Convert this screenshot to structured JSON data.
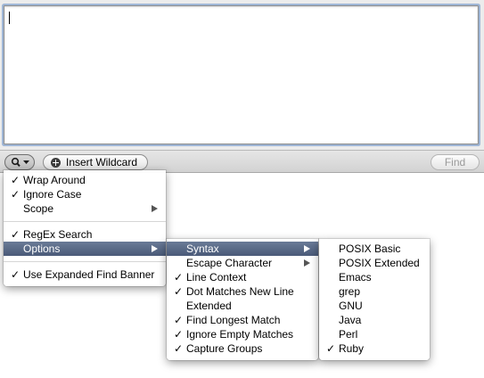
{
  "find_panel": {
    "find_button_label": "Find",
    "insert_wildcard_label": "Insert Wildcard",
    "search_options_icon": "magnifier-dropdown-icon"
  },
  "menu_main": {
    "items": [
      {
        "label": "Wrap Around",
        "checked": true
      },
      {
        "label": "Ignore Case",
        "checked": true
      },
      {
        "label": "Scope",
        "submenu": true
      },
      {
        "label": "RegEx Search",
        "checked": true
      },
      {
        "label": "Options",
        "submenu": true,
        "highlighted": true
      },
      {
        "label": "Use Expanded Find Banner",
        "checked": true
      }
    ]
  },
  "menu_options": {
    "items": [
      {
        "label": "Syntax",
        "submenu": true,
        "highlighted": true
      },
      {
        "label": "Escape Character",
        "submenu": true
      },
      {
        "label": "Line Context",
        "checked": true
      },
      {
        "label": "Dot Matches New Line",
        "checked": true
      },
      {
        "label": "Extended",
        "checked": false
      },
      {
        "label": "Find Longest Match",
        "checked": true
      },
      {
        "label": "Ignore Empty Matches",
        "checked": true
      },
      {
        "label": "Capture Groups",
        "checked": true
      }
    ]
  },
  "menu_syntax": {
    "items": [
      {
        "label": "POSIX Basic"
      },
      {
        "label": "POSIX Extended"
      },
      {
        "label": "Emacs"
      },
      {
        "label": "grep"
      },
      {
        "label": "GNU"
      },
      {
        "label": "Java"
      },
      {
        "label": "Perl"
      },
      {
        "label": "Ruby",
        "checked": true
      }
    ]
  },
  "checkmark": "✓",
  "colors": {
    "highlight": "#56668a",
    "focus_ring": "#9fb6d6"
  }
}
